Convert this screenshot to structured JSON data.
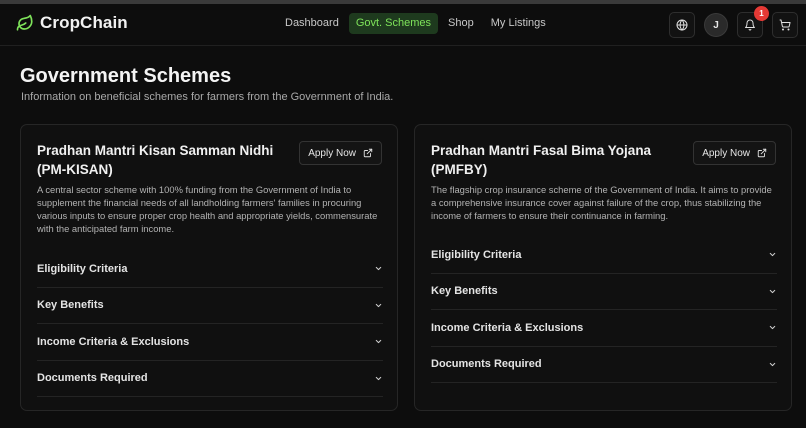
{
  "brand": {
    "name": "CropChain"
  },
  "nav": [
    {
      "label": "Dashboard",
      "active": false
    },
    {
      "label": "Govt. Schemes",
      "active": true
    },
    {
      "label": "Shop",
      "active": false
    },
    {
      "label": "My Listings",
      "active": false
    }
  ],
  "header": {
    "avatar_initial": "J",
    "notification_count": "1"
  },
  "page": {
    "title": "Government Schemes",
    "subtitle": "Information on beneficial schemes for farmers from the Government of India."
  },
  "schemes": [
    {
      "title": "Pradhan Mantri Kisan Samman Nidhi (PM-KISAN)",
      "apply_label": "Apply Now",
      "description": "A central sector scheme with 100% funding from the Government of India to supplement the financial needs of all landholding farmers' families in procuring various inputs to ensure proper crop health and appropriate yields, commensurate with the anticipated farm income.",
      "sections": [
        "Eligibility Criteria",
        "Key Benefits",
        "Income Criteria & Exclusions",
        "Documents Required"
      ]
    },
    {
      "title": "Pradhan Mantri Fasal Bima Yojana (PMFBY)",
      "apply_label": "Apply Now",
      "description": "The flagship crop insurance scheme of the Government of India. It aims to provide a comprehensive insurance cover against failure of the crop, thus stabilizing the income of farmers to ensure their continuance in farming.",
      "sections": [
        "Eligibility Criteria",
        "Key Benefits",
        "Income Criteria & Exclusions",
        "Documents Required"
      ]
    }
  ],
  "colors": {
    "accent": "#7ee35a",
    "accent_bg": "#1e3a1e",
    "badge": "#e53935",
    "background": "#0d0d0d"
  }
}
